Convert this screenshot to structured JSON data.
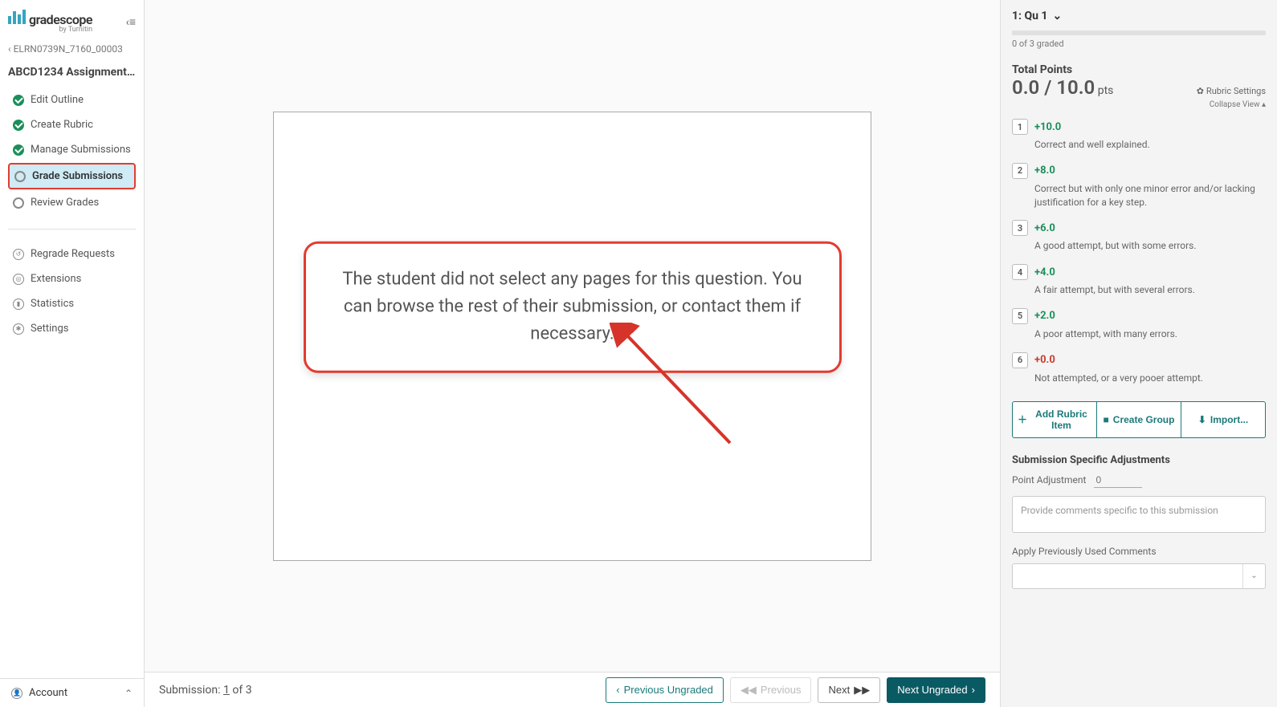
{
  "logo": {
    "text": "gradescope",
    "subtitle": "by Turnitin"
  },
  "breadcrumb": "‹ ELRN0739N_7160_00003",
  "assignment_title": "ABCD1234 Assignment...",
  "nav": {
    "edit_outline": "Edit Outline",
    "create_rubric": "Create Rubric",
    "manage_submissions": "Manage Submissions",
    "grade_submissions": "Grade Submissions",
    "review_grades": "Review Grades",
    "regrade_requests": "Regrade Requests",
    "extensions": "Extensions",
    "statistics": "Statistics",
    "settings": "Settings"
  },
  "account_label": "Account",
  "main_message": "The student did not select any pages for this question. You can browse the rest of their submission, or contact them if necessary.",
  "bottom": {
    "submission_label": "Submission: ",
    "submission_current": "1",
    "submission_of": " of 3",
    "prev_ungraded": "Previous Ungraded",
    "previous": "Previous",
    "next": "Next",
    "next_ungraded": "Next Ungraded"
  },
  "right": {
    "question_label": "1: Qu 1",
    "graded_text": "0 of 3 graded",
    "total_points_label": "Total Points",
    "score": "0.0 / 10.0",
    "pts_label": " pts",
    "rubric_settings": "Rubric Settings",
    "collapse_view": "Collapse View ▴",
    "rubric": [
      {
        "key": "1",
        "points": "+10.0",
        "desc": "Correct and well explained.",
        "color": "green"
      },
      {
        "key": "2",
        "points": "+8.0",
        "desc": "Correct but with only one minor error and/or lacking justification for a key step.",
        "color": "green"
      },
      {
        "key": "3",
        "points": "+6.0",
        "desc": "A good attempt, but with some errors.",
        "color": "green"
      },
      {
        "key": "4",
        "points": "+4.0",
        "desc": "A fair attempt, but with several errors.",
        "color": "green"
      },
      {
        "key": "5",
        "points": "+2.0",
        "desc": "A poor attempt, with many errors.",
        "color": "green"
      },
      {
        "key": "6",
        "points": "+0.0",
        "desc": "Not attempted, or a very pooer attempt.",
        "color": "red"
      }
    ],
    "add_rubric": "Add Rubric Item",
    "create_group": "Create Group",
    "import": "Import...",
    "ssa_title": "Submission Specific Adjustments",
    "point_adjustment_label": "Point Adjustment",
    "point_adjustment_placeholder": "0",
    "comment_placeholder": "Provide comments specific to this submission",
    "prev_comments_label": "Apply Previously Used Comments"
  }
}
